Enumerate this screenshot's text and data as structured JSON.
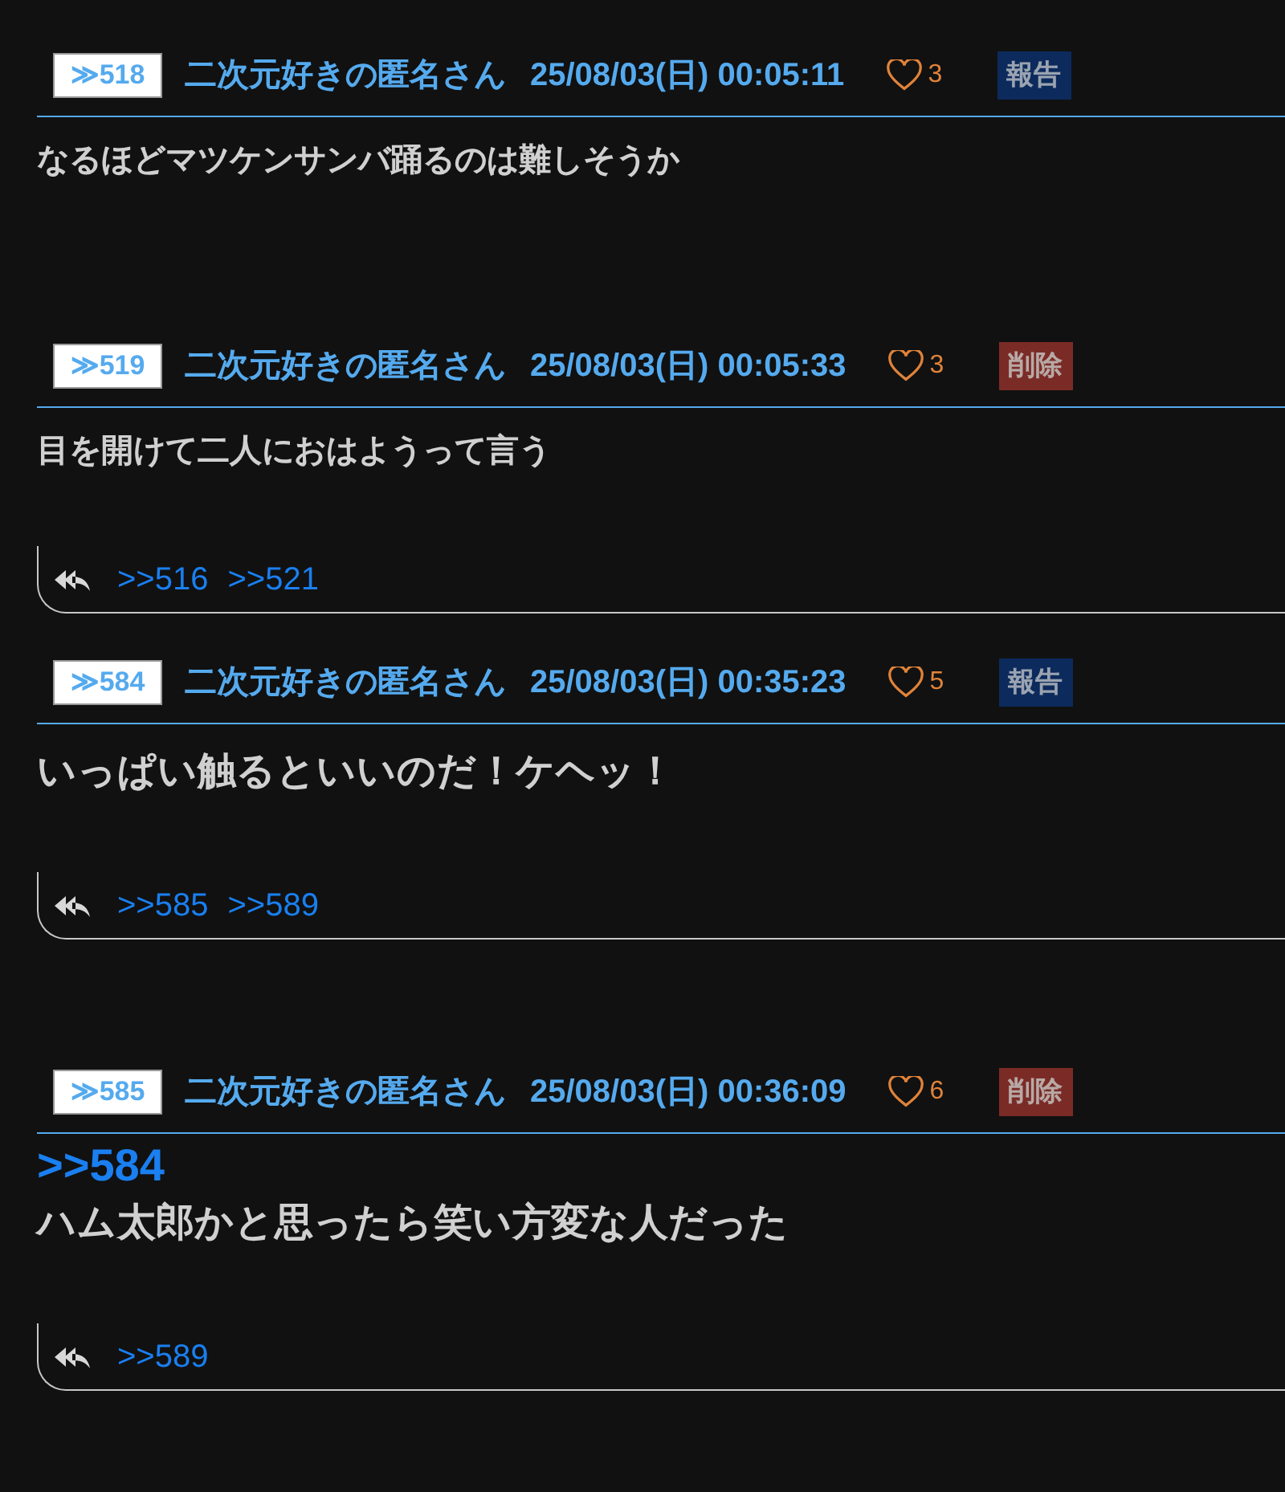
{
  "posts": [
    {
      "number": "≫518",
      "name": "二次元好きの匿名さん",
      "date": "25/08/03(日) 00:05:11",
      "likes": "3",
      "action": {
        "kind": "report",
        "label": "報告"
      },
      "kind": "normal",
      "body": "なるほどマツケンサンバ踊るのは難しそうか"
    },
    {
      "number": "≫519",
      "name": "二次元好きの匿名さん",
      "date": "25/08/03(日) 00:05:33",
      "likes": "3",
      "action": {
        "kind": "delete",
        "label": "削除"
      },
      "kind": "normal",
      "body": "目を開けて二人におはようって言う",
      "replies": [
        ">>516",
        ">>521"
      ]
    },
    {
      "number": "≫584",
      "name": "二次元好きの匿名さん",
      "date": "25/08/03(日) 00:35:23",
      "likes": "5",
      "action": {
        "kind": "report",
        "label": "報告"
      },
      "kind": "large",
      "body": "いっぱい触るといいのだ！ケヘッ！",
      "replies": [
        ">>585",
        ">>589"
      ]
    },
    {
      "number": "≫585",
      "name": "二次元好きの匿名さん",
      "date": "25/08/03(日) 00:36:09",
      "likes": "6",
      "action": {
        "kind": "delete",
        "label": "削除"
      },
      "kind": "large",
      "anchor": ">>584",
      "body": "ハム太郎かと思ったら笑い方変な人だった",
      "replies": [
        ">>589"
      ]
    }
  ]
}
